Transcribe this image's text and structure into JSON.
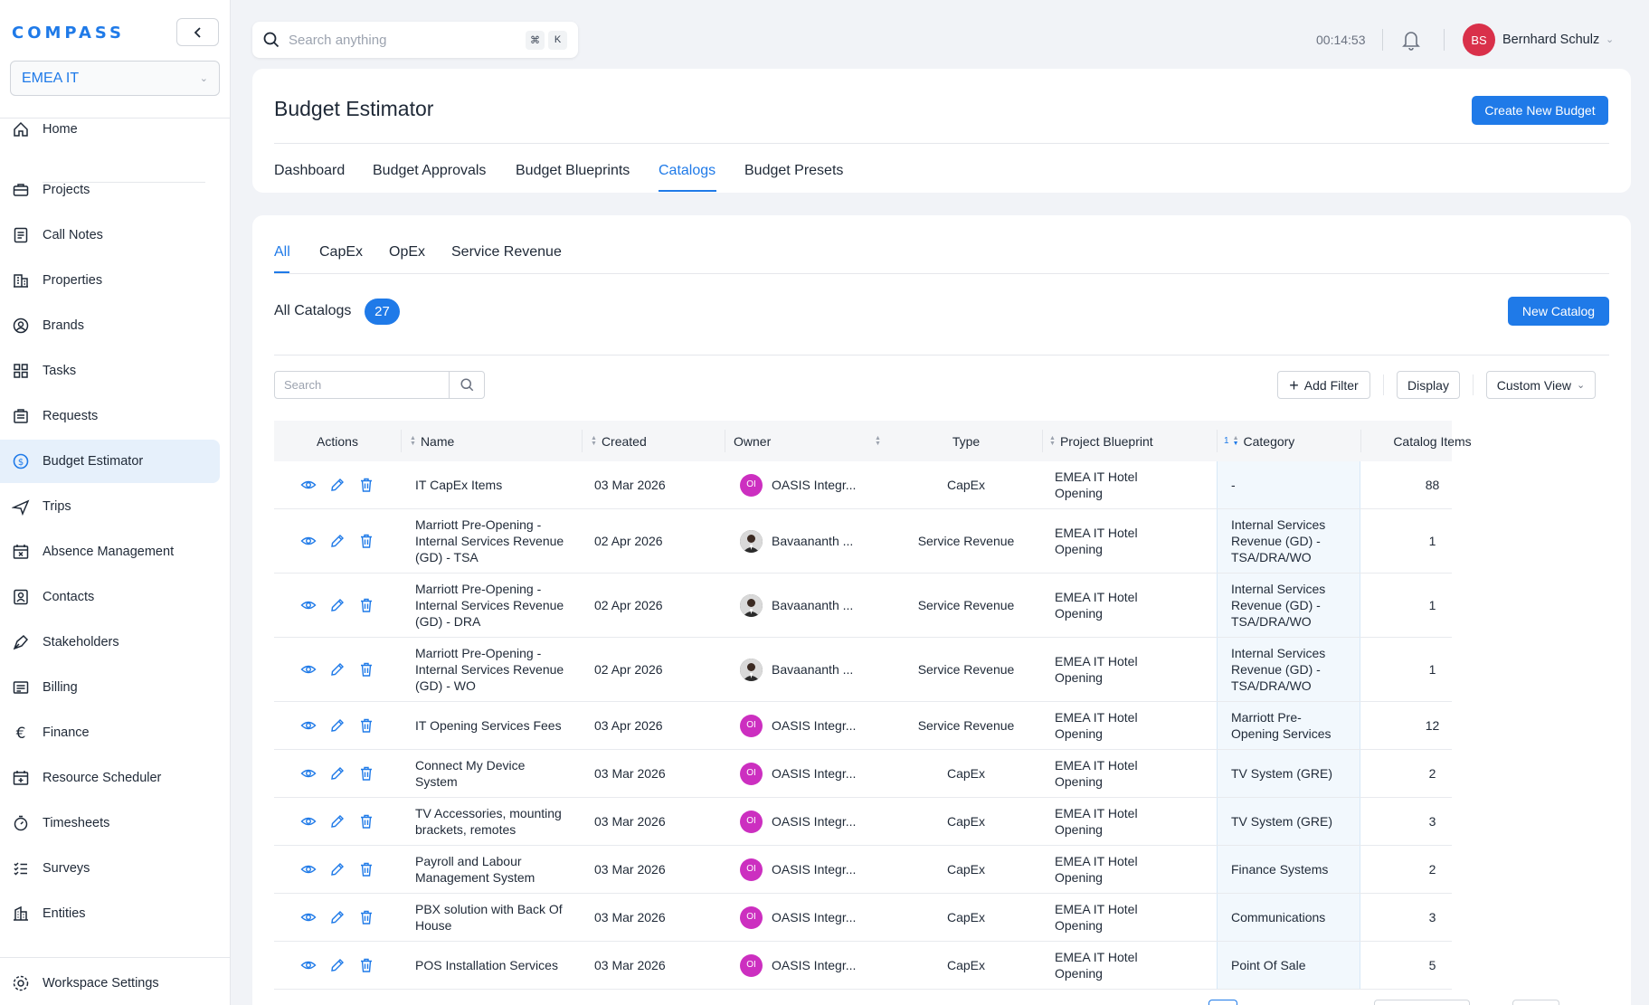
{
  "app": {
    "logo": "COMPASS",
    "workspace": "EMEA IT"
  },
  "sidebar": {
    "items": [
      {
        "label": "Home",
        "icon": "home-icon"
      },
      {
        "label": "Projects",
        "icon": "briefcase-icon"
      },
      {
        "label": "Call Notes",
        "icon": "notes-icon"
      },
      {
        "label": "Properties",
        "icon": "building-icon"
      },
      {
        "label": "Brands",
        "icon": "badge-icon"
      },
      {
        "label": "Tasks",
        "icon": "grid-icon"
      },
      {
        "label": "Requests",
        "icon": "request-icon"
      },
      {
        "label": "Budget Estimator",
        "icon": "dollar-circle-icon"
      },
      {
        "label": "Trips",
        "icon": "plane-icon"
      },
      {
        "label": "Absence Management",
        "icon": "calendar-x-icon"
      },
      {
        "label": "Contacts",
        "icon": "contact-icon"
      },
      {
        "label": "Stakeholders",
        "icon": "pen-tool-icon"
      },
      {
        "label": "Billing",
        "icon": "receipt-icon"
      },
      {
        "label": "Finance",
        "icon": "euro-icon"
      },
      {
        "label": "Resource Scheduler",
        "icon": "calendar-plus-icon"
      },
      {
        "label": "Timesheets",
        "icon": "stopwatch-icon"
      },
      {
        "label": "Surveys",
        "icon": "checklist-icon"
      },
      {
        "label": "Entities",
        "icon": "buildings-icon"
      }
    ],
    "settings": {
      "label": "Workspace Settings",
      "icon": "gear-icon"
    }
  },
  "topbar": {
    "search_placeholder": "Search anything",
    "shortcut_cmd": "⌘",
    "shortcut_key": "K",
    "timer": "00:14:53",
    "user_initials": "BS",
    "user_name": "Bernhard Schulz"
  },
  "header": {
    "title": "Budget Estimator",
    "create_button": "Create New Budget",
    "tabs": [
      "Dashboard",
      "Budget Approvals",
      "Budget Blueprints",
      "Catalogs",
      "Budget Presets"
    ],
    "active_tab": "Catalogs"
  },
  "catalogs": {
    "subtabs": [
      "All",
      "CapEx",
      "OpEx",
      "Service Revenue"
    ],
    "active_subtab": "All",
    "heading": "All Catalogs",
    "count": "27",
    "new_button": "New Catalog",
    "search_placeholder": "Search",
    "add_filter": "Add Filter",
    "display": "Display",
    "custom_view": "Custom View"
  },
  "table": {
    "columns": {
      "actions": "Actions",
      "name": "Name",
      "created": "Created",
      "owner": "Owner",
      "type": "Type",
      "blueprint": "Project Blueprint",
      "category_sort_index": "1",
      "category": "Category",
      "items": "Catalog Items"
    },
    "rows": [
      {
        "name": [
          "IT CapEx Items"
        ],
        "created": "03 Mar 2026",
        "owner": "OASIS Integr...",
        "owner_initials": "OI",
        "owner_photo": false,
        "type": "CapEx",
        "blueprint": [
          "EMEA IT Hotel",
          "Opening"
        ],
        "category": [
          "-"
        ],
        "items": "88",
        "height": 53
      },
      {
        "name": [
          "Marriott Pre-Opening -",
          "Internal Services Revenue",
          "(GD) - TSA"
        ],
        "created": "02 Apr 2026",
        "owner": "Bavaananth ...",
        "owner_initials": "",
        "owner_photo": true,
        "type": "Service Revenue",
        "blueprint": [
          "EMEA IT Hotel",
          "Opening"
        ],
        "category": [
          "Internal Services",
          "Revenue (GD) -",
          "TSA/DRA/WO"
        ],
        "items": "1",
        "height": 71
      },
      {
        "name": [
          "Marriott Pre-Opening -",
          "Internal Services Revenue",
          "(GD) - DRA"
        ],
        "created": "02 Apr 2026",
        "owner": "Bavaananth ...",
        "owner_initials": "",
        "owner_photo": true,
        "type": "Service Revenue",
        "blueprint": [
          "EMEA IT Hotel",
          "Opening"
        ],
        "category": [
          "Internal Services",
          "Revenue (GD) -",
          "TSA/DRA/WO"
        ],
        "items": "1",
        "height": 71
      },
      {
        "name": [
          "Marriott Pre-Opening -",
          "Internal Services Revenue",
          "(GD) - WO"
        ],
        "created": "02 Apr 2026",
        "owner": "Bavaananth ...",
        "owner_initials": "",
        "owner_photo": true,
        "type": "Service Revenue",
        "blueprint": [
          "EMEA IT Hotel",
          "Opening"
        ],
        "category": [
          "Internal Services",
          "Revenue (GD) -",
          "TSA/DRA/WO"
        ],
        "items": "1",
        "height": 71
      },
      {
        "name": [
          "IT Opening Services Fees"
        ],
        "created": "03 Apr 2026",
        "owner": "OASIS Integr...",
        "owner_initials": "OI",
        "owner_photo": false,
        "type": "Service Revenue",
        "blueprint": [
          "EMEA IT Hotel",
          "Opening"
        ],
        "category": [
          "Marriott Pre-",
          "Opening Services"
        ],
        "items": "12",
        "height": 53
      },
      {
        "name": [
          "Connect My Device",
          "System"
        ],
        "created": "03 Mar 2026",
        "owner": "OASIS Integr...",
        "owner_initials": "OI",
        "owner_photo": false,
        "type": "CapEx",
        "blueprint": [
          "EMEA IT Hotel",
          "Opening"
        ],
        "category": [
          "TV System (GRE)"
        ],
        "items": "2",
        "height": 53
      },
      {
        "name": [
          "TV Accessories, mounting",
          "brackets, remotes"
        ],
        "created": "03 Mar 2026",
        "owner": "OASIS Integr...",
        "owner_initials": "OI",
        "owner_photo": false,
        "type": "CapEx",
        "blueprint": [
          "EMEA IT Hotel",
          "Opening"
        ],
        "category": [
          "TV System (GRE)"
        ],
        "items": "3",
        "height": 53
      },
      {
        "name": [
          "Payroll and Labour",
          "Management System"
        ],
        "created": "03 Mar 2026",
        "owner": "OASIS Integr...",
        "owner_initials": "OI",
        "owner_photo": false,
        "type": "CapEx",
        "blueprint": [
          "EMEA IT Hotel",
          "Opening"
        ],
        "category": [
          "Finance Systems"
        ],
        "items": "2",
        "height": 53
      },
      {
        "name": [
          "PBX solution with Back Of",
          "House"
        ],
        "created": "03 Mar 2026",
        "owner": "OASIS Integr...",
        "owner_initials": "OI",
        "owner_photo": false,
        "type": "CapEx",
        "blueprint": [
          "EMEA IT Hotel",
          "Opening"
        ],
        "category": [
          "Communications"
        ],
        "items": "3",
        "height": 53
      },
      {
        "name": [
          "POS Installation Services"
        ],
        "created": "03 Mar 2026",
        "owner": "OASIS Integr...",
        "owner_initials": "OI",
        "owner_photo": false,
        "type": "CapEx",
        "blueprint": [
          "EMEA IT Hotel",
          "Opening"
        ],
        "category": [
          "Point Of Sale"
        ],
        "items": "5",
        "height": 53
      }
    ]
  },
  "colors": {
    "accent": "#1f7ae8",
    "avatar_user": "#d9304a",
    "avatar_oi": "#cc2fc0"
  }
}
